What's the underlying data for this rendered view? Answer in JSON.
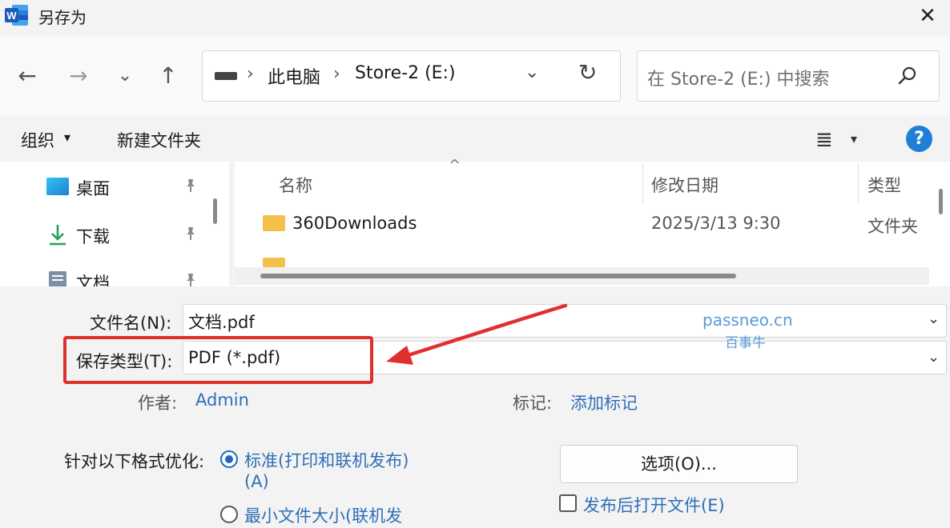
{
  "window": {
    "title": "另存为",
    "close_glyph": "✕",
    "app_icon_letter": "W"
  },
  "nav": {
    "back_glyph": "←",
    "forward_glyph": "→",
    "recent_glyph": "⌄",
    "up_glyph": "↑",
    "breadcrumb": [
      "此电脑",
      "Store-2 (E:)"
    ],
    "crumb_sep": "›",
    "dropdown_glyph": "⌄",
    "refresh_glyph": "↻",
    "search_placeholder": "在 Store-2 (E:) 中搜索"
  },
  "toolbar": {
    "organize_label": "组织",
    "caret": "▾",
    "new_folder_label": "新建文件夹",
    "view_glyph": "≣",
    "help_glyph": "?"
  },
  "left_pane": {
    "items": [
      {
        "label": "桌面",
        "icon": "desktop-icon"
      },
      {
        "label": "下载",
        "icon": "download-icon"
      },
      {
        "label": "文档",
        "icon": "document-icon"
      }
    ],
    "pin_glyph": "📌"
  },
  "file_list": {
    "sort_glyph": "^",
    "columns": [
      "名称",
      "修改日期",
      "类型"
    ],
    "rows": [
      {
        "name": "360Downloads",
        "modified": "2025/3/13 9:30",
        "type": "文件夹"
      }
    ]
  },
  "save": {
    "filename_label": "文件名(N):",
    "filename_value": "文档.pdf",
    "type_label": "保存类型(T):",
    "type_value": "PDF (*.pdf)",
    "combo_caret": "⌄",
    "author_label": "作者:",
    "author_value": "Admin",
    "tags_label": "标记:",
    "tags_value": "添加标记",
    "optimize_label": "针对以下格式优化:",
    "opt_standard_line1": "标准(打印和联机发布)",
    "opt_standard_line2": "(A)",
    "opt_minimum": "最小文件大小(联机发",
    "options_button": "选项(O)...",
    "open_after_label": "发布后打开文件(E)"
  },
  "watermark": {
    "line1": "passneo.cn",
    "line2": "百事牛"
  },
  "colors": {
    "accent": "#1f66c5",
    "highlight": "#e0302e",
    "link": "#2f6fb7"
  }
}
